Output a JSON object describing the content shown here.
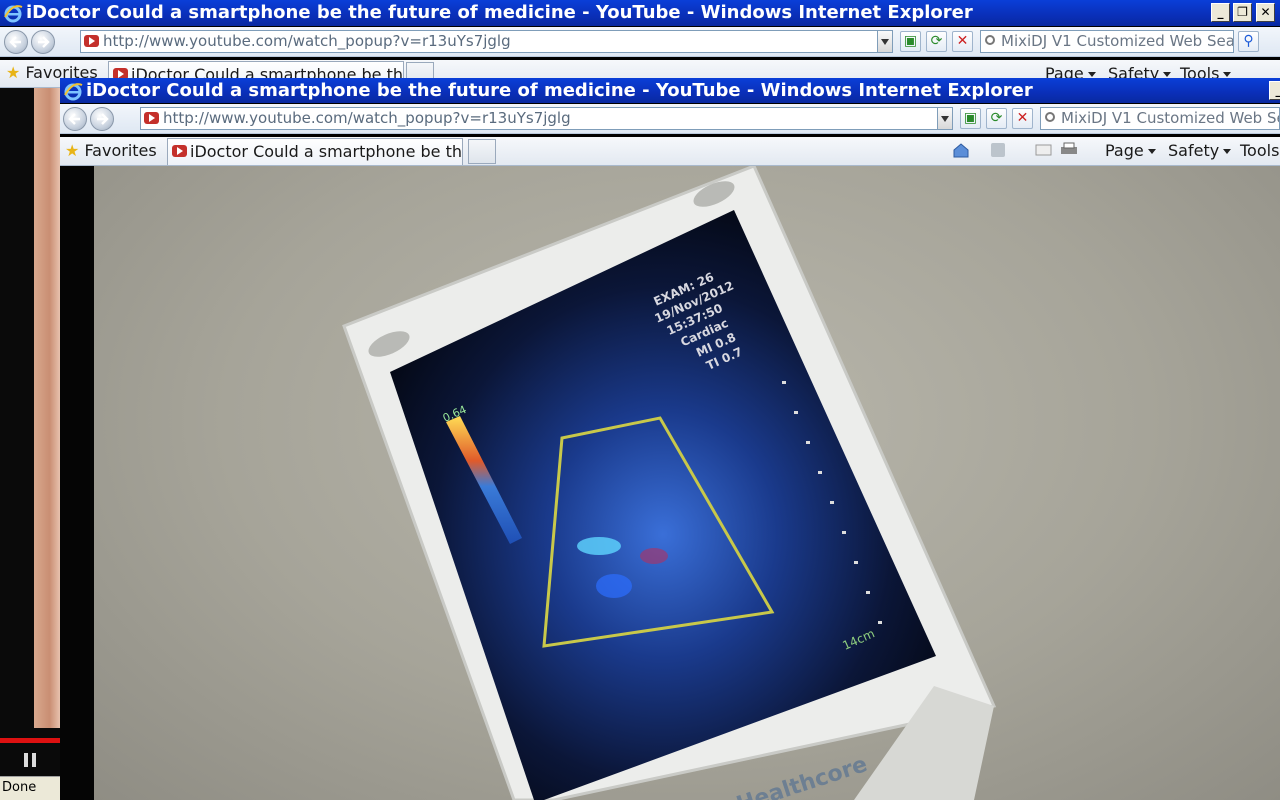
{
  "back_window": {
    "title": "iDoctor Could a smartphone be the future of medicine - YouTube - Windows Internet Explorer",
    "address": "http://www.youtube.com/watch_popup?v=r13uYs7jglg",
    "search_placeholder": "MixiDJ V1 Customized Web Sear",
    "favorites_label": "Favorites",
    "tab_label": "iDoctor Could a smartphone be the ...",
    "commands": {
      "page": "Page",
      "safety": "Safety",
      "tools": "Tools"
    }
  },
  "front_window": {
    "title": "iDoctor Could a smartphone be the future of medicine - YouTube - Windows Internet Explorer",
    "address": "http://www.youtube.com/watch_popup?v=r13uYs7jglg",
    "search_placeholder": "MixiDJ V1 Customized Web Sear",
    "favorites_label": "Favorites",
    "tab_label": "iDoctor Could a smartphone be the ...",
    "commands": {
      "page": "Page",
      "safety": "Safety",
      "tools": "Tools"
    }
  },
  "status_bar": {
    "text": "Done"
  },
  "video": {
    "device_brand": "Healthcore",
    "scan_info": [
      "EXAM: 26",
      "19/Nov/2012",
      "15:37:50",
      "Cardiac",
      "MI 0.8",
      "TI 0.7"
    ],
    "gain_label": "0.64",
    "depth_label": "14cm"
  },
  "colors": {
    "titlebar": "#0a2fb8",
    "accent_red": "#c4302b"
  },
  "icons": [
    "ie-logo-icon",
    "back-icon",
    "forward-icon",
    "refresh-icon",
    "stop-icon",
    "search-icon",
    "star-icon",
    "home-icon",
    "print-icon",
    "pause-icon"
  ]
}
